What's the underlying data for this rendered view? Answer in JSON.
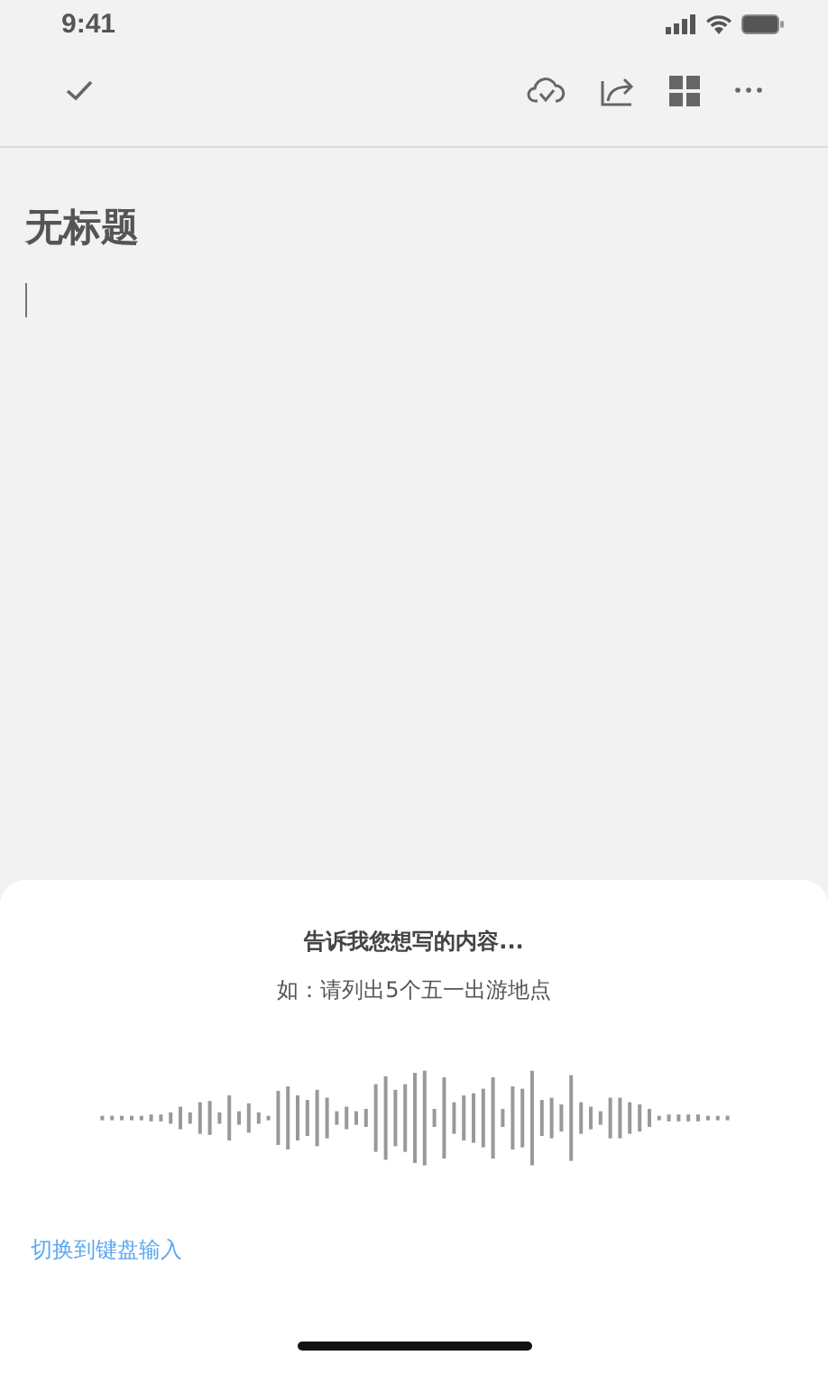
{
  "status_bar": {
    "time": "9:41"
  },
  "document": {
    "title": "无标题"
  },
  "voice_panel": {
    "prompt": "告诉我您想写的内容...",
    "example": "如：请列出5个五一出游地点",
    "switch_link": "切换到键盘输入"
  }
}
